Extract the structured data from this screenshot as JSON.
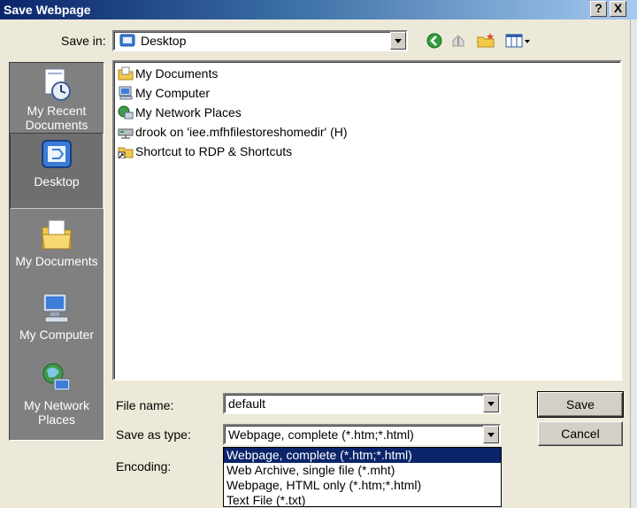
{
  "window": {
    "title": "Save Webpage",
    "help_label": "?",
    "close_label": "X"
  },
  "save_in": {
    "label": "Save in:",
    "value": "Desktop"
  },
  "places": [
    {
      "label": "My Recent Documents",
      "icon": "recent-documents-icon"
    },
    {
      "label": "Desktop",
      "icon": "desktop-icon",
      "selected": true
    },
    {
      "label": "My Documents",
      "icon": "my-documents-icon"
    },
    {
      "label": "My Computer",
      "icon": "my-computer-icon"
    },
    {
      "label": "My Network Places",
      "icon": "network-places-icon"
    }
  ],
  "files": [
    {
      "label": "My Documents",
      "icon": "folder-documents-icon"
    },
    {
      "label": "My Computer",
      "icon": "computer-icon"
    },
    {
      "label": "My Network Places",
      "icon": "network-icon"
    },
    {
      "label": "drook on 'iee.mfhfilestoreshomedir' (H)",
      "icon": "network-drive-icon"
    },
    {
      "label": "Shortcut to RDP & Shortcuts",
      "icon": "folder-shortcut-icon"
    }
  ],
  "file_name": {
    "label": "File name:",
    "value": "default"
  },
  "save_as_type": {
    "label": "Save as type:",
    "value": "Webpage, complete (*.htm;*.html)",
    "options": [
      "Webpage, complete (*.htm;*.html)",
      "Web Archive, single file (*.mht)",
      "Webpage, HTML only (*.htm;*.html)",
      "Text File (*.txt)"
    ],
    "highlighted": 0
  },
  "encoding": {
    "label": "Encoding:"
  },
  "buttons": {
    "save": "Save",
    "cancel": "Cancel"
  },
  "colors": {
    "title_start": "#0a246a",
    "highlight": "#0a246a",
    "face": "#ece9d8"
  }
}
